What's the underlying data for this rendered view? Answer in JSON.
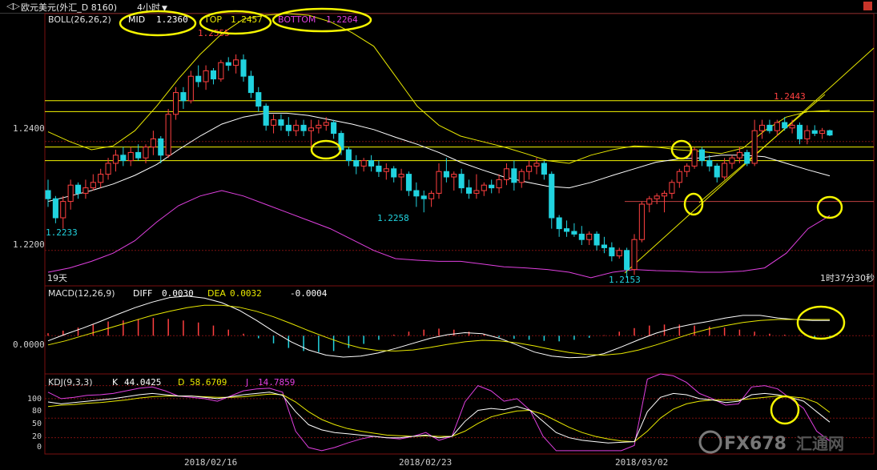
{
  "header": {
    "back_label": "◁▷",
    "symbol_label": "欧元美元(外汇_D 8160)",
    "period_label": "4小时"
  },
  "boll": {
    "label": "BOLL(26,26,2)",
    "mid_label": "MID",
    "mid_value": "1.2360",
    "top_label": "TOP",
    "top_value": "1.2457",
    "bottom_label": "BOTTOM",
    "bottom_value": "1.2264"
  },
  "macd": {
    "label": "MACD(12,26,9)",
    "diff_label": "DIFF",
    "diff_value": "0.0030",
    "dea_label": "DEA",
    "dea_value": "0.0032",
    "macd_value": "-0.0004"
  },
  "kdj": {
    "label": "KDJ(9,3,3)",
    "k_label": "K",
    "k_value": "44.0425",
    "d_label": "D",
    "d_value": "58.6709",
    "j_label": "J",
    "j_value": "14.7859"
  },
  "annotations": {
    "high_label": "1.2555",
    "low_label_1": "1.2233",
    "low_label_2": "1.2258",
    "low_label_3": "1.2153",
    "recent_high_label": "1.2443",
    "days_label": "19天",
    "countdown_label": "1时37分30秒"
  },
  "watermark": {
    "text": "FX678",
    "sub": "汇通网"
  },
  "colors": {
    "up": "#ff4040",
    "down": "#21d3df",
    "mid": "#ffffff",
    "top": "#e8e800",
    "bottom": "#e040e0",
    "highlight": "#f5f500",
    "grid": "#7a1010"
  },
  "chart_data": [
    {
      "type": "candlestick",
      "title": "欧元美元 4小时",
      "y_ticks": [
        "1.2400",
        "1.2200"
      ],
      "y_range": [
        1.2135,
        1.2635
      ],
      "x_tick_labels": [
        "2018/02/16",
        "2018/02/23",
        "2018/03/02"
      ],
      "horizontal_levels": [
        1.2475,
        1.2455,
        1.239,
        1.2365,
        1.229
      ],
      "bar_count": 105,
      "candles": [
        [
          1.231,
          1.233,
          1.228,
          1.2295
        ],
        [
          1.2295,
          1.23,
          1.225,
          1.226
        ],
        [
          1.226,
          1.23,
          1.224,
          1.229
        ],
        [
          1.229,
          1.233,
          1.2275,
          1.232
        ],
        [
          1.232,
          1.2325,
          1.2295,
          1.2305
        ],
        [
          1.2305,
          1.233,
          1.2295,
          1.2315
        ],
        [
          1.2315,
          1.234,
          1.231,
          1.2325
        ],
        [
          1.2325,
          1.235,
          1.2315,
          1.234
        ],
        [
          1.234,
          1.237,
          1.233,
          1.236
        ],
        [
          1.236,
          1.2385,
          1.2345,
          1.2375
        ],
        [
          1.2375,
          1.239,
          1.2355,
          1.2365
        ],
        [
          1.2365,
          1.239,
          1.2355,
          1.238
        ],
        [
          1.238,
          1.2395,
          1.2365,
          1.237
        ],
        [
          1.237,
          1.2395,
          1.236,
          1.239
        ],
        [
          1.239,
          1.242,
          1.2375,
          1.2405
        ],
        [
          1.2405,
          1.241,
          1.236,
          1.2375
        ],
        [
          1.2375,
          1.246,
          1.237,
          1.245
        ],
        [
          1.245,
          1.25,
          1.244,
          1.249
        ],
        [
          1.249,
          1.25,
          1.246,
          1.2475
        ],
        [
          1.2475,
          1.253,
          1.247,
          1.252
        ],
        [
          1.252,
          1.254,
          1.25,
          1.251
        ],
        [
          1.251,
          1.254,
          1.2495,
          1.253
        ],
        [
          1.253,
          1.2535,
          1.2505,
          1.2515
        ],
        [
          1.2515,
          1.255,
          1.251,
          1.2545
        ],
        [
          1.2545,
          1.2555,
          1.253,
          1.254
        ],
        [
          1.254,
          1.256,
          1.2525,
          1.255
        ],
        [
          1.255,
          1.256,
          1.251,
          1.252
        ],
        [
          1.252,
          1.253,
          1.248,
          1.249
        ],
        [
          1.249,
          1.25,
          1.2455,
          1.2465
        ],
        [
          1.2465,
          1.247,
          1.242,
          1.243
        ],
        [
          1.243,
          1.245,
          1.2415,
          1.244
        ],
        [
          1.244,
          1.245,
          1.242,
          1.243
        ],
        [
          1.243,
          1.2445,
          1.241,
          1.242
        ],
        [
          1.242,
          1.244,
          1.241,
          1.243
        ],
        [
          1.243,
          1.244,
          1.241,
          1.242
        ],
        [
          1.242,
          1.244,
          1.2385,
          1.2425
        ],
        [
          1.2425,
          1.244,
          1.2415,
          1.243
        ],
        [
          1.243,
          1.2445,
          1.242,
          1.2435
        ],
        [
          1.2435,
          1.244,
          1.2405,
          1.2415
        ],
        [
          1.2415,
          1.242,
          1.2375,
          1.2385
        ],
        [
          1.2385,
          1.239,
          1.2355,
          1.2365
        ],
        [
          1.2365,
          1.2375,
          1.234,
          1.2355
        ],
        [
          1.2355,
          1.237,
          1.2345,
          1.2365
        ],
        [
          1.2365,
          1.2375,
          1.2345,
          1.2355
        ],
        [
          1.2355,
          1.2365,
          1.2335,
          1.2345
        ],
        [
          1.2345,
          1.236,
          1.233,
          1.235
        ],
        [
          1.235,
          1.2355,
          1.2325,
          1.2335
        ],
        [
          1.2335,
          1.235,
          1.231,
          1.234
        ],
        [
          1.234,
          1.2345,
          1.23,
          1.231
        ],
        [
          1.231,
          1.2325,
          1.228,
          1.23
        ],
        [
          1.23,
          1.231,
          1.227,
          1.2295
        ],
        [
          1.2295,
          1.231,
          1.228,
          1.2305
        ],
        [
          1.2305,
          1.236,
          1.2295,
          1.2345
        ],
        [
          1.2345,
          1.237,
          1.2325,
          1.2335
        ],
        [
          1.2335,
          1.2345,
          1.231,
          1.234
        ],
        [
          1.234,
          1.235,
          1.2305,
          1.2315
        ],
        [
          1.2315,
          1.233,
          1.2295,
          1.2305
        ],
        [
          1.2305,
          1.234,
          1.2295,
          1.231
        ],
        [
          1.231,
          1.2325,
          1.23,
          1.232
        ],
        [
          1.232,
          1.233,
          1.2305,
          1.2315
        ],
        [
          1.2315,
          1.234,
          1.2305,
          1.233
        ],
        [
          1.233,
          1.236,
          1.232,
          1.235
        ],
        [
          1.235,
          1.2365,
          1.231,
          1.2325
        ],
        [
          1.2325,
          1.235,
          1.2315,
          1.2345
        ],
        [
          1.2345,
          1.2365,
          1.233,
          1.2355
        ],
        [
          1.2355,
          1.237,
          1.234,
          1.236
        ],
        [
          1.236,
          1.2365,
          1.233,
          1.234
        ],
        [
          1.234,
          1.2345,
          1.224,
          1.226
        ],
        [
          1.226,
          1.2265,
          1.2225,
          1.224
        ],
        [
          1.224,
          1.2255,
          1.2225,
          1.2235
        ],
        [
          1.2235,
          1.225,
          1.2225,
          1.223
        ],
        [
          1.223,
          1.2245,
          1.221,
          1.222
        ],
        [
          1.222,
          1.2235,
          1.221,
          1.223
        ],
        [
          1.223,
          1.2235,
          1.22,
          1.221
        ],
        [
          1.221,
          1.2225,
          1.2195,
          1.2205
        ],
        [
          1.2205,
          1.2215,
          1.218,
          1.219
        ],
        [
          1.219,
          1.2205,
          1.2185,
          1.22
        ],
        [
          1.22,
          1.2205,
          1.215,
          1.2165
        ],
        [
          1.2165,
          1.223,
          1.2155,
          1.222
        ],
        [
          1.222,
          1.229,
          1.2215,
          1.2285
        ],
        [
          1.2285,
          1.23,
          1.227,
          1.2295
        ],
        [
          1.2295,
          1.2305,
          1.2285,
          1.23
        ],
        [
          1.23,
          1.231,
          1.227,
          1.2305
        ],
        [
          1.2305,
          1.233,
          1.2295,
          1.2325
        ],
        [
          1.2325,
          1.235,
          1.2315,
          1.2345
        ],
        [
          1.2345,
          1.236,
          1.2335,
          1.2355
        ],
        [
          1.2355,
          1.239,
          1.235,
          1.2385
        ],
        [
          1.2385,
          1.239,
          1.2355,
          1.2365
        ],
        [
          1.2365,
          1.2375,
          1.2345,
          1.2355
        ],
        [
          1.2355,
          1.236,
          1.2325,
          1.2335
        ],
        [
          1.2335,
          1.237,
          1.233,
          1.236
        ],
        [
          1.236,
          1.2375,
          1.235,
          1.237
        ],
        [
          1.237,
          1.239,
          1.236,
          1.238
        ],
        [
          1.238,
          1.2385,
          1.2355,
          1.236
        ],
        [
          1.236,
          1.244,
          1.2355,
          1.242
        ],
        [
          1.242,
          1.244,
          1.2405,
          1.243
        ],
        [
          1.243,
          1.244,
          1.2415,
          1.242
        ],
        [
          1.242,
          1.244,
          1.241,
          1.2435
        ],
        [
          1.2435,
          1.2445,
          1.242,
          1.2425
        ],
        [
          1.2425,
          1.244,
          1.2415,
          1.243
        ],
        [
          1.243,
          1.2435,
          1.2395,
          1.2405
        ],
        [
          1.2405,
          1.243,
          1.2395,
          1.242
        ],
        [
          1.242,
          1.243,
          1.241,
          1.2415
        ],
        [
          1.2415,
          1.2425,
          1.2405,
          1.242
        ],
        [
          1.242,
          1.2422,
          1.241,
          1.2412
        ]
      ],
      "mid": [
        1.229,
        1.23,
        1.231,
        1.2322,
        1.2338,
        1.2358,
        1.2385,
        1.241,
        1.2432,
        1.2445,
        1.2452,
        1.2452,
        1.2448,
        1.244,
        1.2432,
        1.2422,
        1.2408,
        1.2395,
        1.238,
        1.2362,
        1.2348,
        1.2335,
        1.2326,
        1.2318,
        1.2315,
        1.2325,
        1.2338,
        1.235,
        1.2362,
        1.2368,
        1.237,
        1.2375,
        1.2375,
        1.2372,
        1.236,
        1.2348,
        1.2337
      ],
      "top": [
        1.2418,
        1.24,
        1.2385,
        1.2392,
        1.242,
        1.2465,
        1.2515,
        1.256,
        1.2598,
        1.2625,
        1.2632,
        1.2635,
        1.2632,
        1.262,
        1.26,
        1.2575,
        1.252,
        1.2465,
        1.243,
        1.241,
        1.24,
        1.239,
        1.2378,
        1.2365,
        1.236,
        1.2375,
        1.2385,
        1.2392,
        1.239,
        1.2385,
        1.2382,
        1.2378,
        1.2388,
        1.242,
        1.2445,
        1.2455,
        1.2457
      ],
      "bottom": [
        1.216,
        1.2168,
        1.218,
        1.2195,
        1.2218,
        1.2252,
        1.2282,
        1.23,
        1.231,
        1.23,
        1.2285,
        1.227,
        1.2255,
        1.224,
        1.222,
        1.22,
        1.2185,
        1.2182,
        1.218,
        1.218,
        1.2175,
        1.217,
        1.2168,
        1.2165,
        1.216,
        1.215,
        1.216,
        1.2165,
        1.2163,
        1.2162,
        1.216,
        1.216,
        1.2162,
        1.2168,
        1.2195,
        1.224,
        1.2264
      ]
    },
    {
      "type": "bar",
      "title": "MACD(12,26,9)",
      "y_ticks": [
        "0.0000"
      ],
      "y_range": [
        -0.0075,
        0.0098
      ],
      "histogram": [
        0.0005,
        0.001,
        0.0016,
        0.0022,
        0.0028,
        0.003,
        0.0033,
        0.0035,
        0.0033,
        0.003,
        0.0026,
        0.002,
        0.0012,
        0.0004,
        -0.0005,
        -0.0015,
        -0.0024,
        -0.003,
        -0.0032,
        -0.003,
        -0.0024,
        -0.0016,
        -0.0008,
        0.0002,
        0.0008,
        0.0012,
        0.0014,
        0.0012,
        0.0008,
        0.0003,
        -0.0003,
        -0.0006,
        -0.0008,
        -0.001,
        -0.0011,
        -0.0008,
        -0.0004,
        0.0001,
        0.0008,
        0.0015,
        0.002,
        0.0022,
        0.0022,
        0.002,
        0.0018,
        0.0016,
        0.0012,
        0.0008,
        0.0004,
        0.0002,
        0.0001,
        -0.0004,
        -0.0004
      ],
      "diff": [
        -0.001,
        0.0003,
        0.0015,
        0.0028,
        0.0042,
        0.0055,
        0.0066,
        0.0075,
        0.0078,
        0.0074,
        0.0065,
        0.005,
        0.003,
        0.0008,
        -0.0012,
        -0.0028,
        -0.0038,
        -0.0042,
        -0.004,
        -0.0034,
        -0.0025,
        -0.0015,
        -0.0005,
        0.0002,
        0.0006,
        0.0004,
        -0.0005,
        -0.0018,
        -0.0032,
        -0.004,
        -0.0043,
        -0.0042,
        -0.0035,
        -0.0022,
        -0.0008,
        0.0005,
        0.0015,
        0.0022,
        0.0028,
        0.0035,
        0.004,
        0.004,
        0.0035,
        0.0032,
        0.003,
        0.003
      ],
      "dea": [
        -0.0018,
        -0.001,
        0.0,
        0.001,
        0.002,
        0.003,
        0.004,
        0.0048,
        0.0055,
        0.006,
        0.006,
        0.0056,
        0.0048,
        0.0037,
        0.0024,
        0.001,
        -0.0003,
        -0.0015,
        -0.0024,
        -0.0029,
        -0.003,
        -0.0028,
        -0.0023,
        -0.0017,
        -0.0012,
        -0.0009,
        -0.001,
        -0.0014,
        -0.002,
        -0.0027,
        -0.0033,
        -0.0037,
        -0.0038,
        -0.0035,
        -0.0028,
        -0.0018,
        -0.0007,
        0.0004,
        0.0013,
        0.002,
        0.0026,
        0.003,
        0.0032,
        0.0032,
        0.0032,
        0.0032
      ]
    },
    {
      "type": "line",
      "title": "KDJ(9,3,3)",
      "y_ticks": [
        "100",
        "80",
        "50",
        "20",
        "0"
      ],
      "y_range": [
        -5,
        118
      ],
      "k": [
        75,
        72,
        74,
        76,
        78,
        80,
        83,
        86,
        88,
        86,
        84,
        84,
        82,
        80,
        83,
        86,
        88,
        90,
        85,
        60,
        40,
        32,
        28,
        26,
        24,
        22,
        20,
        20,
        22,
        24,
        20,
        22,
        45,
        62,
        65,
        63,
        68,
        62,
        45,
        28,
        20,
        16,
        14,
        12,
        13,
        14,
        60,
        82,
        88,
        86,
        80,
        78,
        74,
        76,
        86,
        88,
        86,
        82,
        76,
        60,
        44
      ],
      "d": [
        68,
        70,
        71,
        73,
        74,
        76,
        78,
        81,
        83,
        84,
        84,
        84,
        83,
        82,
        82,
        83,
        85,
        87,
        86,
        75,
        60,
        48,
        40,
        34,
        30,
        27,
        24,
        23,
        22,
        23,
        22,
        22,
        30,
        42,
        52,
        57,
        61,
        62,
        56,
        46,
        36,
        28,
        22,
        18,
        15,
        14,
        30,
        50,
        64,
        72,
        76,
        78,
        78,
        78,
        80,
        82,
        84,
        83,
        81,
        74,
        59
      ],
      "j": [
        90,
        80,
        82,
        85,
        86,
        88,
        92,
        96,
        98,
        92,
        84,
        82,
        80,
        76,
        84,
        92,
        95,
        96,
        90,
        30,
        5,
        0,
        5,
        12,
        18,
        22,
        20,
        18,
        22,
        28,
        16,
        22,
        75,
        100,
        92,
        76,
        80,
        62,
        22,
        0,
        0,
        0,
        0,
        0,
        0,
        8,
        110,
        118,
        115,
        105,
        88,
        80,
        70,
        72,
        98,
        100,
        95,
        80,
        65,
        30,
        15
      ]
    }
  ]
}
